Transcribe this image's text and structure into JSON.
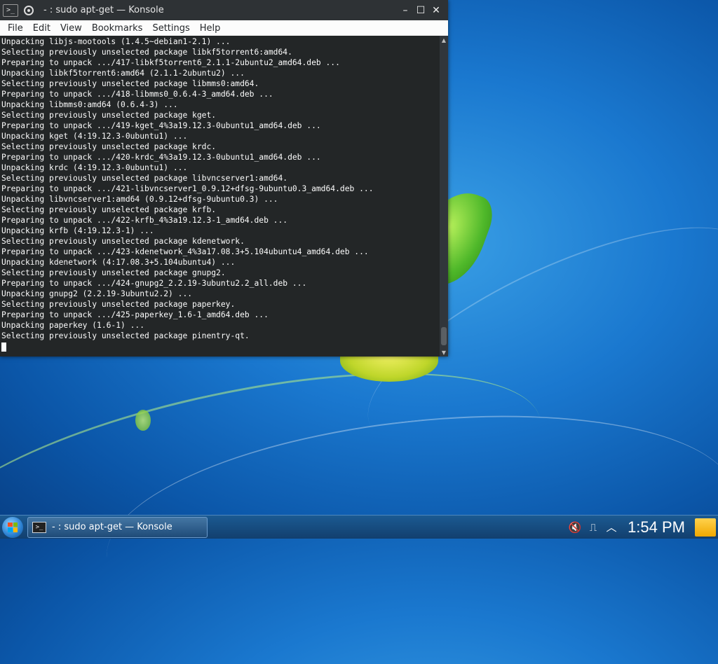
{
  "window": {
    "title": "- : sudo apt-get — Konsole",
    "menu": [
      "File",
      "Edit",
      "View",
      "Bookmarks",
      "Settings",
      "Help"
    ],
    "controls": {
      "minimize": "–",
      "maximize": "☐",
      "close": "✕"
    }
  },
  "terminal": {
    "lines": [
      "Unpacking libjs-mootools (1.4.5~debian1-2.1) ...",
      "Selecting previously unselected package libkf5torrent6:amd64.",
      "Preparing to unpack .../417-libkf5torrent6_2.1.1-2ubuntu2_amd64.deb ...",
      "Unpacking libkf5torrent6:amd64 (2.1.1-2ubuntu2) ...",
      "Selecting previously unselected package libmms0:amd64.",
      "Preparing to unpack .../418-libmms0_0.6.4-3_amd64.deb ...",
      "Unpacking libmms0:amd64 (0.6.4-3) ...",
      "Selecting previously unselected package kget.",
      "Preparing to unpack .../419-kget_4%3a19.12.3-0ubuntu1_amd64.deb ...",
      "Unpacking kget (4:19.12.3-0ubuntu1) ...",
      "Selecting previously unselected package krdc.",
      "Preparing to unpack .../420-krdc_4%3a19.12.3-0ubuntu1_amd64.deb ...",
      "Unpacking krdc (4:19.12.3-0ubuntu1) ...",
      "Selecting previously unselected package libvncserver1:amd64.",
      "Preparing to unpack .../421-libvncserver1_0.9.12+dfsg-9ubuntu0.3_amd64.deb ...",
      "Unpacking libvncserver1:amd64 (0.9.12+dfsg-9ubuntu0.3) ...",
      "Selecting previously unselected package krfb.",
      "Preparing to unpack .../422-krfb_4%3a19.12.3-1_amd64.deb ...",
      "Unpacking krfb (4:19.12.3-1) ...",
      "Selecting previously unselected package kdenetwork.",
      "Preparing to unpack .../423-kdenetwork_4%3a17.08.3+5.104ubuntu4_amd64.deb ...",
      "Unpacking kdenetwork (4:17.08.3+5.104ubuntu4) ...",
      "Selecting previously unselected package gnupg2.",
      "Preparing to unpack .../424-gnupg2_2.2.19-3ubuntu2.2_all.deb ...",
      "Unpacking gnupg2 (2.2.19-3ubuntu2.2) ...",
      "Selecting previously unselected package paperkey.",
      "Preparing to unpack .../425-paperkey_1.6-1_amd64.deb ...",
      "Unpacking paperkey (1.6-1) ...",
      "Selecting previously unselected package pinentry-qt."
    ]
  },
  "taskbar": {
    "task_label": "- : sudo apt-get — Konsole",
    "clock": "1:54 PM",
    "tray_icons": [
      "volume-muted-icon",
      "usb-device-icon",
      "show-hidden-icons-icon"
    ]
  },
  "colors": {
    "terminal_bg": "#232627",
    "terminal_fg": "#fcfcfc",
    "titlebar_bg": "#2e3235",
    "taskbar_bg": "#1b5a92"
  }
}
